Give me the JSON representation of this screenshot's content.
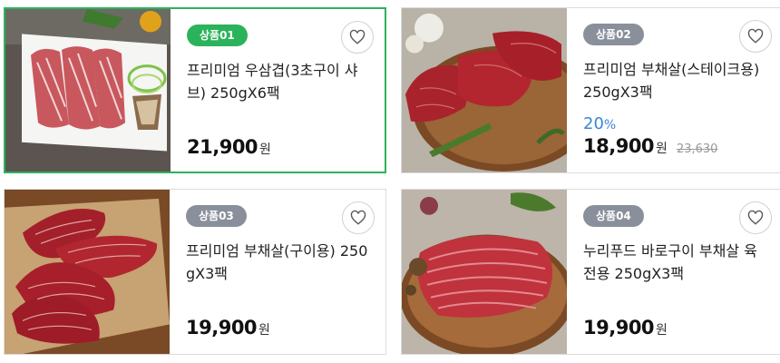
{
  "currency_unit": "원",
  "products": [
    {
      "badge": "상품01",
      "name": "프리미엄 우삼겹(3초구이 샤브) 250gX6팩",
      "price": "21,900",
      "discount": "",
      "original_price": "",
      "selected": true,
      "badge_color": "#2bb35b",
      "image": "sliced-brisket-plate"
    },
    {
      "badge": "상품02",
      "name": "프리미엄 부채살(스테이크용) 250gX3팩",
      "price": "18,900",
      "discount": "20",
      "discount_unit": "%",
      "original_price": "23,630",
      "selected": false,
      "badge_color": "#8a8f9c",
      "image": "steak-cuts-board"
    },
    {
      "badge": "상품03",
      "name": "프리미엄 부채살(구이용) 250gX3팩",
      "price": "19,900",
      "discount": "",
      "original_price": "",
      "selected": false,
      "badge_color": "#8a8f9c",
      "image": "marbled-cuts-paper"
    },
    {
      "badge": "상품04",
      "name": "누리푸드 바로구이 부채살 육전용 250gX3팩",
      "price": "19,900",
      "discount": "",
      "original_price": "",
      "selected": false,
      "badge_color": "#8a8f9c",
      "image": "thin-slices-board"
    }
  ],
  "icons": {
    "wishlist": "heart-outline-icon"
  }
}
